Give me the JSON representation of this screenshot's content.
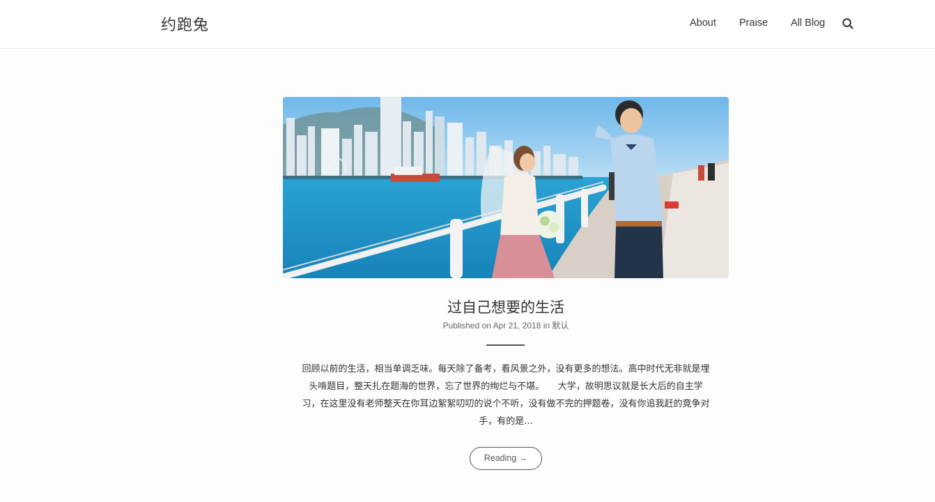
{
  "site": {
    "brand": "约跑兔"
  },
  "nav": {
    "items": [
      {
        "label": "About"
      },
      {
        "label": "Praise"
      },
      {
        "label": "All Blog"
      }
    ],
    "search_icon": "search-icon"
  },
  "post": {
    "image_alt": "photo-couple-harbor",
    "title": "过自己想要的生活",
    "published_prefix": "Published on",
    "date": "Apr 21, 2018",
    "in_word": "in",
    "category": "默认",
    "excerpt": "回顾以前的生活，相当单调乏味。每天除了备考，看风景之外，没有更多的想法。高中时代无非就是埋头啃题目，整天扎在题海的世界，忘了世界的绚烂与不堪。　　大学，故明思议就是长大后的自主学习，在这里没有老师整天在你耳边絮絮叨叨的说个不听，没有做不完的押题卷，没有你追我赶的竟争对手，有的是...",
    "read_more": "Reading →"
  },
  "colors": {
    "text": "#333333",
    "meta": "#666666",
    "sky": "#8cc7ee",
    "sea": "#2f9fcf"
  }
}
